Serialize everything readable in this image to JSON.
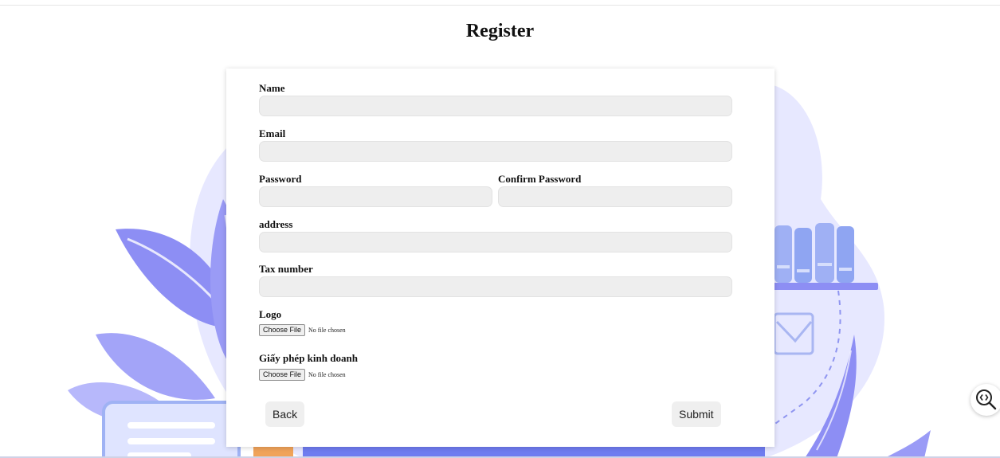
{
  "page": {
    "title": "Register"
  },
  "form": {
    "name_label": "Name",
    "email_label": "Email",
    "password_label": "Password",
    "confirm_password_label": "Confirm Password",
    "address_label": "address",
    "tax_number_label": "Tax number",
    "logo_label": "Logo",
    "business_license_label": "Giấy phép kinh doanh",
    "name_value": "",
    "email_value": "",
    "password_value": "",
    "confirm_password_value": "",
    "address_value": "",
    "tax_number_value": "",
    "file_button_label": "Choose File",
    "file_status": "No file chosen"
  },
  "actions": {
    "back_label": "Back",
    "submit_label": "Submit"
  },
  "colors": {
    "illustration_primary": "#8f8ff5",
    "illustration_light": "#e6e7ff",
    "input_background": "#eeeeee",
    "button_background": "#efefef"
  },
  "icons": {
    "zoom_widget": "zoom-code-icon"
  }
}
